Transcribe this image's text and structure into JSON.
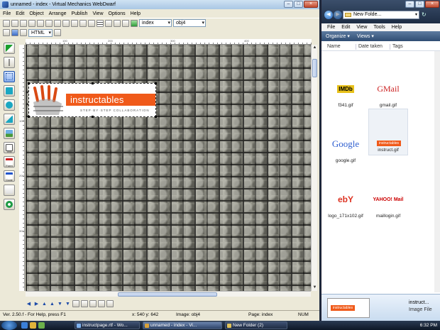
{
  "webdwarf": {
    "title": "unnamed - index - Virtual Mechanics WebDwarf",
    "menu": [
      "File",
      "Edit",
      "Object",
      "Arrange",
      "Publish",
      "View",
      "Options",
      "Help"
    ],
    "page_select": "index",
    "object_select": "obj4",
    "format_select": "HTML",
    "tools": [
      "select-arrow",
      "pointer",
      "rectangle",
      "circle",
      "polygon",
      "image",
      "text",
      "form",
      "code",
      "link"
    ],
    "ruler_labels": [
      "100",
      "200",
      "300",
      "400",
      "100",
      "200",
      "300"
    ],
    "logo": {
      "word": "instructables",
      "tagline": "STEP·BY·STEP COLLABORATION"
    },
    "status": {
      "left": "Ver. 2.50.f - For Help, press F1",
      "coords": "x: 540  y: 642",
      "image": "Image: obj4",
      "page": "Page:  index",
      "num": "NUM"
    }
  },
  "explorer": {
    "address": "New Folde...",
    "menu": [
      "File",
      "Edit",
      "View",
      "Tools",
      "Help"
    ],
    "commands": [
      "Organize ▾",
      "Views ▾"
    ],
    "columns": [
      "Name",
      "Date taken",
      "Tags"
    ],
    "files": [
      {
        "name": "f341.gif",
        "thumb": "IMDb"
      },
      {
        "name": "gmail.gif",
        "thumb": "GMail"
      },
      {
        "name": "google.gif",
        "thumb": "Google"
      },
      {
        "name": "instruct.gif",
        "thumb": "instructables"
      },
      {
        "name": "logo_171x102.gif",
        "thumb": "ebY"
      },
      {
        "name": "maillogin.gif",
        "thumb": "YAHOO! Mail"
      }
    ],
    "detail": {
      "name": "instruct...",
      "type": "Image File",
      "preview": "instructables"
    }
  },
  "taskbar": {
    "tasks": [
      "instructpage.rtf - Wo...",
      "unnamed - index - Vi...",
      "New Folder (2)"
    ],
    "clock": "6:32 PM"
  },
  "colors": {
    "instructables_orange": "#f05a1a",
    "vista_blue": "#2f4c72"
  }
}
